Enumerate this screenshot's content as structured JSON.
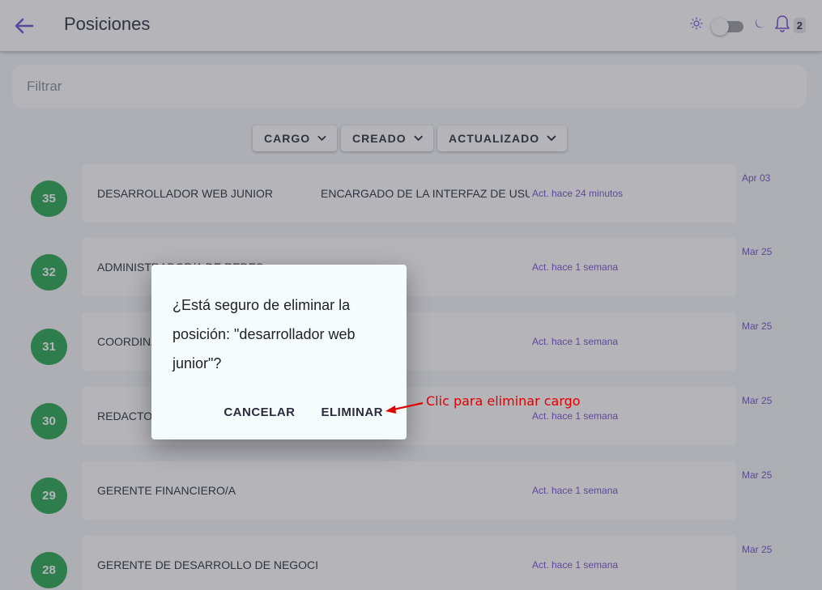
{
  "header": {
    "title": "Posiciones",
    "notification_count": "2",
    "icons": [
      "back-arrow-icon",
      "sun-icon",
      "theme-toggle",
      "moon-icon",
      "bell-icon"
    ]
  },
  "filter": {
    "placeholder": "Filtrar"
  },
  "sort_buttons": [
    {
      "label": "CARGO"
    },
    {
      "label": "CREADO"
    },
    {
      "label": "ACTUALIZADO"
    }
  ],
  "positions": [
    {
      "id": "35",
      "name": "DESARROLLADOR WEB JUNIOR",
      "description": "ENCARGADO DE LA INTERFAZ DE USUARIO",
      "updated": "Act. hace 24 minutos",
      "date": "Apr 03"
    },
    {
      "id": "32",
      "name": "ADMINISTRADOR/A DE REDES",
      "description": "",
      "updated": "Act. hace 1 semana",
      "date": "Mar 25"
    },
    {
      "id": "31",
      "name": "COORDINADOR/A",
      "description": "",
      "updated": "Act. hace 1 semana",
      "date": "Mar 25"
    },
    {
      "id": "30",
      "name": "REDACTOR/A",
      "description": "",
      "updated": "Act. hace 1 semana",
      "date": "Mar 25"
    },
    {
      "id": "29",
      "name": "GERENTE FINANCIERO/A",
      "description": "",
      "updated": "Act. hace 1 semana",
      "date": "Mar 25"
    },
    {
      "id": "28",
      "name": "GERENTE DE DESARROLLO DE NEGOCI",
      "description": "",
      "updated": "Act. hace 1 semana",
      "date": "Mar 25"
    }
  ],
  "dialog": {
    "message": "¿Está seguro de eliminar la posición: \"desarrollador web junior\"?",
    "cancel_label": "CANCELAR",
    "delete_label": "ELIMINAR"
  },
  "annotation": {
    "text": "Clic para eliminar cargo",
    "color": "#e00000"
  },
  "colors": {
    "accent": "#6d4ed0",
    "badge_green": "#26a552"
  }
}
